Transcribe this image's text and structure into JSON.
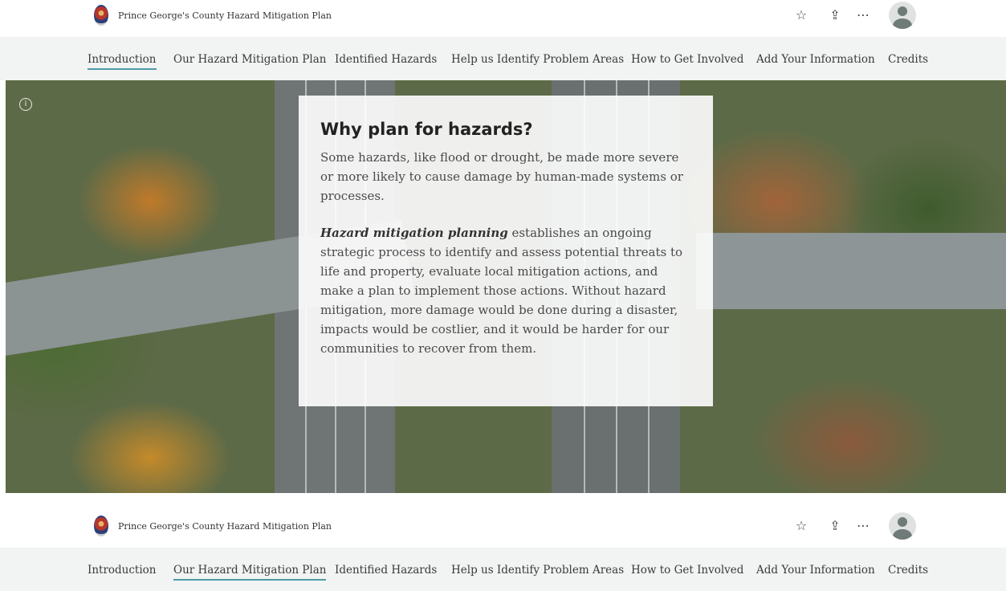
{
  "header": {
    "site_title": "Prince George's County Hazard Mitigation Plan",
    "actions": [
      "star-icon",
      "share-icon",
      "more-icon"
    ],
    "action_glyphs": {
      "star": "☆",
      "share": "⇪",
      "more": "⋯"
    }
  },
  "nav": {
    "items": [
      "Introduction",
      "Our Hazard Mitigation Plan",
      "Identified Hazards",
      "Help us Identify Problem Areas",
      "How to Get Involved",
      "Add Your Information",
      "Credits"
    ],
    "accent_color": "#4f9aa8"
  },
  "hero": {
    "heading": "Why plan for hazards?",
    "paragraph1": "Some hazards, like flood or drought,  be made more severe or more likely to cause damage by human-made systems or processes.",
    "paragraph2_emphasis": "Hazard mitigation planning",
    "paragraph2_rest": " establishes an ongoing strategic process to identify and assess potential threats to life and property, evaluate local mitigation actions, and make a plan to implement those actions. Without hazard mitigation, more damage would be done during a disaster, impacts would be costlier, and it would be harder for our communities to recover from them.",
    "info_glyph": "i"
  }
}
